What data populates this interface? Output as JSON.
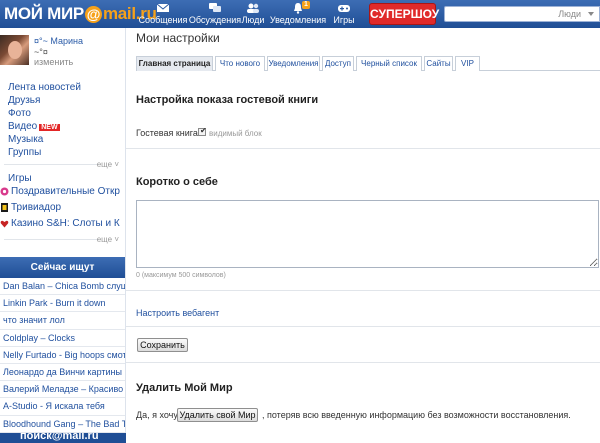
{
  "brand": {
    "logo": {
      "name": "МОЙ МИР",
      "at": "@",
      "domain": "mail.ru"
    },
    "accent": "#f6a11a",
    "bar_color": "#2a5aa3"
  },
  "topnav": {
    "items": [
      {
        "label": "Сообщения",
        "icon": "envelope-icon"
      },
      {
        "label": "Обсуждения",
        "icon": "speech-bubbles-icon"
      },
      {
        "label": "Люди",
        "icon": "people-icon"
      },
      {
        "label": "Уведомления",
        "icon": "bell-icon",
        "badge": "1"
      },
      {
        "label": "Игры",
        "icon": "gamepad-icon"
      }
    ],
    "super_button": "СУПЕРШОУ",
    "search": {
      "scope": "Люди"
    }
  },
  "sidebar": {
    "profile": {
      "name": "¤°~ Марина",
      "status": "~°¤",
      "edit": "изменить"
    },
    "menu": [
      {
        "label": "Лента новостей"
      },
      {
        "label": "Друзья"
      },
      {
        "label": "Фото"
      },
      {
        "label": "Видео",
        "badge": "NEW"
      },
      {
        "label": "Музыка"
      },
      {
        "label": "Группы"
      }
    ],
    "more_label": "еще",
    "apps_title": "Игры",
    "apps": [
      {
        "label": "Поздравительные Открытки",
        "icon": "postcard-app-icon"
      },
      {
        "label": "Тривиадор",
        "icon": "triviador-app-icon"
      },
      {
        "label": "Казино S&H: Слоты и Картошка",
        "icon": "casino-app-icon"
      }
    ],
    "more_label_2": "еще",
    "trending": {
      "title": "Сейчас ищут",
      "items": [
        "Dan Balan – Chica Bomb слушать",
        "Linkin Park - Burn it down",
        "что значит лол",
        "Coldplay – Clocks",
        "Nelly Furtado - Big hoops смотреть",
        "Леонардо да Винчи картины",
        "Валерий Меладзе – Красиво",
        "A-Studio - Я искала тебя",
        "Bloodhound Gang – The Bad Touch"
      ]
    },
    "poisk_label": "поиск@mail.ru"
  },
  "main": {
    "title": "Мои настройки",
    "tabs": [
      {
        "label": "Главная страница",
        "active": true
      },
      {
        "label": "Что нового"
      },
      {
        "label": "Уведомления"
      },
      {
        "label": "Доступ"
      },
      {
        "label": "Черный список"
      },
      {
        "label": "Сайты"
      },
      {
        "label": "VIP"
      }
    ],
    "guestbook": {
      "heading": "Настройка показа гостевой книги",
      "label": "Гостевая книга",
      "checkbox_label": "видимый блок",
      "checked": true
    },
    "about": {
      "heading": "Коротко о себе",
      "value": "",
      "hint": "0 (максимум 500 символов)"
    },
    "webagent_link": "Настроить вебагент",
    "save_button": "Сохранить",
    "delete": {
      "heading": "Удалить Мой Мир",
      "prefix": "Да, я хочу",
      "button": "Удалить свой Мир",
      "suffix": ", потеряв всю введенную информацию без возможности восстановления."
    }
  }
}
